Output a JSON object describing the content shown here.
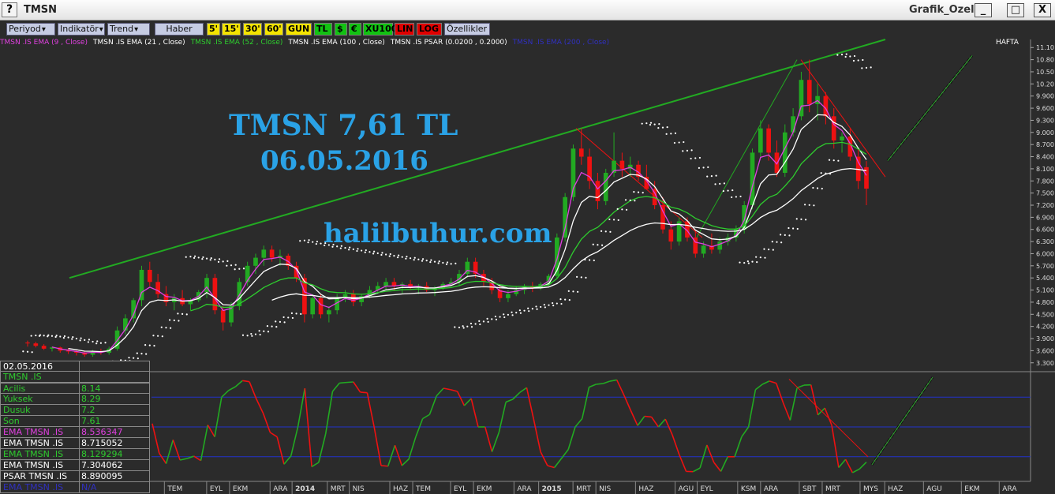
{
  "window": {
    "help_label": "?",
    "app_title": "TMSN",
    "doc_title": "Grafik_Ozel",
    "minimize_label": "_",
    "maximize_label": "□",
    "close_label": "X"
  },
  "toolbar": {
    "periyod": "Periyod",
    "indikator": "Indikatör",
    "trend": "Trend",
    "haber": "Haber",
    "t5": "5'",
    "t15": "15'",
    "t30": "30'",
    "t60": "60'",
    "gun": "GUN",
    "tl": "TL",
    "dollar": "$",
    "euro": "€",
    "xu100": "XU100",
    "lin": "LIN",
    "log": "LOG",
    "ozellikler": "Özellikler"
  },
  "legend": {
    "ema9": "TMSN .IS EMA (9 , Close)",
    "ema21": "TMSN .IS EMA (21 , Close)",
    "ema52": "TMSN .IS EMA (52 , Close)",
    "ema100": "TMSN .IS EMA (100 , Close)",
    "psar": "TMSN .IS PSAR (0.0200 , 0.2000)",
    "ema200": "TMSN .IS EMA (200 , Close)",
    "period": "HAFTA"
  },
  "watermark": {
    "line1": "TMSN 7,61 TL",
    "line2": "06.05.2016",
    "line3": "halilbuhur.com"
  },
  "colors": {
    "ema9": "#e040e0",
    "ema21": "#ffffff",
    "ema52": "#2ecc2e",
    "ema100": "#ffffff",
    "psar": "#ffffff",
    "ema200": "#3030c0",
    "up": "#22aa22",
    "down": "#ee1111",
    "watermark": "#2aa2e6"
  },
  "info_panel": {
    "date": "02.05.2016",
    "symbol": "TMSN .IS",
    "rows": [
      {
        "key": "Acilis",
        "value": "8.14",
        "color": "#2ecc2e"
      },
      {
        "key": "Yuksek",
        "value": "8.29",
        "color": "#2ecc2e"
      },
      {
        "key": "Dusuk",
        "value": "7.2",
        "color": "#2ecc2e"
      },
      {
        "key": "Son",
        "value": "7.61",
        "color": "#2ecc2e"
      },
      {
        "key": "EMA TMSN .IS",
        "value": "8.536347",
        "color": "#e040e0"
      },
      {
        "key": "EMA TMSN .IS",
        "value": "8.715052",
        "color": "#ffffff"
      },
      {
        "key": "EMA TMSN .IS",
        "value": "8.129294",
        "color": "#2ecc2e"
      },
      {
        "key": "EMA TMSN .IS",
        "value": "7.304062",
        "color": "#ffffff"
      },
      {
        "key": "PSAR TMSN .IS",
        "value": "8.890095",
        "color": "#ffffff"
      },
      {
        "key": "EMA TMSN .IS",
        "value": "N/A",
        "color": "#3030c0"
      }
    ]
  },
  "chart_data": {
    "type": "candlestick",
    "y_ticks": [
      "11.10",
      "10.80",
      "10.50",
      "10.20",
      "9.900",
      "9.600",
      "9.300",
      "9.000",
      "8.700",
      "8.400",
      "8.100",
      "7.800",
      "7.500",
      "7.200",
      "6.900",
      "6.600",
      "6.300",
      "6.000",
      "5.700",
      "5.400",
      "5.100",
      "4.800",
      "4.500",
      "4.200",
      "3.900",
      "3.600",
      "3.300"
    ],
    "ylim": [
      3.1,
      11.3
    ],
    "x_ticks": [
      {
        "label": "TEM",
        "pos": 0.02
      },
      {
        "label": "EYL",
        "pos": 0.068
      },
      {
        "label": "EKM",
        "pos": 0.094
      },
      {
        "label": "ARA",
        "pos": 0.14
      },
      {
        "label": "2014",
        "pos": 0.165
      },
      {
        "label": "MRT",
        "pos": 0.205
      },
      {
        "label": "NIS",
        "pos": 0.23
      },
      {
        "label": "HAZ",
        "pos": 0.276
      },
      {
        "label": "TEM",
        "pos": 0.302
      },
      {
        "label": "EYL",
        "pos": 0.345
      },
      {
        "label": "EKM",
        "pos": 0.371
      },
      {
        "label": "ARA",
        "pos": 0.417
      },
      {
        "label": "2015",
        "pos": 0.445
      },
      {
        "label": "MRT",
        "pos": 0.484
      },
      {
        "label": "NIS",
        "pos": 0.51
      },
      {
        "label": "HAZ",
        "pos": 0.555
      },
      {
        "label": "AGU",
        "pos": 0.6
      },
      {
        "label": "EYL",
        "pos": 0.625
      },
      {
        "label": "KSM",
        "pos": 0.671
      },
      {
        "label": "ARA",
        "pos": 0.697
      },
      {
        "label": "SBT",
        "pos": 0.741
      },
      {
        "label": "MRT",
        "pos": 0.767
      },
      {
        "label": "MYS",
        "pos": 0.81
      },
      {
        "label": "HAZ",
        "pos": 0.838
      },
      {
        "label": "AGU",
        "pos": 0.882
      },
      {
        "label": "EKM",
        "pos": 0.925
      },
      {
        "label": "ARA",
        "pos": 0.968
      }
    ],
    "ohlc": [
      [
        3.8,
        3.85,
        3.7,
        3.78
      ],
      [
        3.78,
        3.82,
        3.68,
        3.72
      ],
      [
        3.72,
        3.76,
        3.62,
        3.65
      ],
      [
        3.65,
        3.7,
        3.58,
        3.68
      ],
      [
        3.68,
        3.7,
        3.55,
        3.6
      ],
      [
        3.6,
        3.66,
        3.52,
        3.58
      ],
      [
        3.58,
        3.62,
        3.48,
        3.55
      ],
      [
        3.55,
        3.6,
        3.45,
        3.5
      ],
      [
        3.5,
        3.62,
        3.45,
        3.58
      ],
      [
        3.58,
        3.65,
        3.5,
        3.55
      ],
      [
        3.55,
        3.7,
        3.5,
        3.65
      ],
      [
        3.65,
        4.2,
        3.6,
        4.1
      ],
      [
        4.1,
        4.5,
        4.0,
        4.4
      ],
      [
        4.4,
        4.9,
        4.3,
        4.85
      ],
      [
        4.85,
        5.7,
        4.7,
        5.6
      ],
      [
        5.6,
        5.8,
        5.2,
        5.3
      ],
      [
        5.3,
        5.5,
        4.9,
        5.0
      ],
      [
        5.0,
        5.2,
        4.7,
        4.8
      ],
      [
        4.8,
        5.0,
        4.6,
        4.9
      ],
      [
        4.9,
        5.1,
        4.7,
        4.75
      ],
      [
        4.75,
        4.9,
        4.6,
        4.85
      ],
      [
        4.85,
        5.1,
        4.8,
        5.05
      ],
      [
        5.05,
        5.5,
        4.9,
        5.4
      ],
      [
        5.4,
        5.5,
        4.5,
        4.6
      ],
      [
        4.6,
        4.7,
        4.1,
        4.3
      ],
      [
        4.3,
        4.8,
        4.2,
        4.7
      ],
      [
        4.7,
        5.4,
        4.6,
        5.3
      ],
      [
        5.3,
        5.8,
        5.2,
        5.7
      ],
      [
        5.7,
        6.0,
        5.5,
        5.9
      ],
      [
        5.9,
        6.2,
        5.7,
        6.1
      ],
      [
        6.1,
        6.2,
        5.8,
        5.9
      ],
      [
        5.9,
        6.1,
        5.7,
        5.95
      ],
      [
        5.95,
        6.0,
        5.6,
        5.7
      ],
      [
        5.7,
        5.8,
        5.3,
        5.4
      ],
      [
        5.4,
        5.5,
        4.3,
        4.5
      ],
      [
        4.5,
        5.0,
        4.4,
        4.9
      ],
      [
        4.9,
        5.0,
        4.4,
        4.5
      ],
      [
        4.5,
        4.7,
        4.3,
        4.6
      ],
      [
        4.6,
        5.0,
        4.5,
        4.9
      ],
      [
        4.9,
        5.1,
        4.8,
        5.0
      ],
      [
        5.0,
        5.1,
        4.7,
        4.8
      ],
      [
        4.8,
        5.0,
        4.7,
        4.95
      ],
      [
        4.95,
        5.2,
        4.9,
        5.1
      ],
      [
        5.1,
        5.3,
        5.0,
        5.2
      ],
      [
        5.2,
        5.4,
        5.1,
        5.3
      ],
      [
        5.3,
        5.4,
        5.1,
        5.2
      ],
      [
        5.2,
        5.3,
        5.0,
        5.25
      ],
      [
        5.25,
        5.35,
        5.1,
        5.15
      ],
      [
        5.15,
        5.25,
        5.0,
        5.2
      ],
      [
        5.2,
        5.3,
        5.05,
        5.1
      ],
      [
        5.1,
        5.2,
        4.95,
        5.15
      ],
      [
        5.15,
        5.3,
        5.1,
        5.25
      ],
      [
        5.25,
        5.4,
        5.2,
        5.3
      ],
      [
        5.3,
        5.6,
        5.2,
        5.5
      ],
      [
        5.5,
        5.9,
        5.4,
        5.8
      ],
      [
        5.8,
        5.9,
        5.4,
        5.5
      ],
      [
        5.5,
        5.6,
        5.2,
        5.3
      ],
      [
        5.3,
        5.4,
        5.0,
        5.1
      ],
      [
        5.1,
        5.2,
        4.8,
        4.9
      ],
      [
        4.9,
        5.1,
        4.8,
        5.0
      ],
      [
        5.0,
        5.2,
        4.95,
        5.1
      ],
      [
        5.1,
        5.25,
        5.0,
        5.2
      ],
      [
        5.2,
        5.3,
        5.05,
        5.15
      ],
      [
        5.15,
        5.3,
        5.1,
        5.25
      ],
      [
        5.25,
        5.5,
        5.2,
        5.45
      ],
      [
        5.45,
        6.5,
        5.4,
        6.4
      ],
      [
        6.4,
        7.5,
        6.3,
        7.4
      ],
      [
        7.4,
        8.7,
        7.3,
        8.6
      ],
      [
        8.6,
        9.1,
        8.2,
        8.4
      ],
      [
        8.4,
        8.6,
        7.6,
        7.8
      ],
      [
        7.8,
        8.0,
        7.1,
        7.3
      ],
      [
        7.3,
        8.1,
        7.2,
        8.0
      ],
      [
        8.0,
        9.0,
        7.9,
        8.3
      ],
      [
        8.3,
        8.5,
        7.9,
        8.1
      ],
      [
        8.1,
        8.4,
        7.9,
        8.2
      ],
      [
        8.2,
        8.3,
        7.8,
        7.9
      ],
      [
        7.9,
        8.2,
        7.7,
        7.6
      ],
      [
        7.6,
        7.8,
        7.1,
        7.2
      ],
      [
        7.2,
        7.4,
        6.5,
        6.6
      ],
      [
        6.6,
        6.8,
        6.1,
        6.3
      ],
      [
        6.3,
        6.9,
        6.2,
        6.8
      ],
      [
        6.8,
        6.9,
        6.3,
        6.4
      ],
      [
        6.4,
        6.6,
        5.9,
        6.0
      ],
      [
        6.0,
        6.3,
        5.9,
        6.2
      ],
      [
        6.2,
        6.5,
        6.0,
        6.1
      ],
      [
        6.1,
        6.4,
        6.0,
        6.3
      ],
      [
        6.3,
        6.5,
        6.2,
        6.4
      ],
      [
        6.4,
        6.7,
        6.3,
        6.6
      ],
      [
        6.6,
        7.3,
        6.5,
        7.2
      ],
      [
        7.2,
        8.6,
        7.1,
        8.5
      ],
      [
        8.5,
        9.3,
        8.4,
        9.1
      ],
      [
        9.1,
        9.2,
        8.3,
        8.5
      ],
      [
        8.5,
        8.8,
        7.9,
        8.0
      ],
      [
        8.0,
        9.2,
        7.9,
        9.0
      ],
      [
        9.0,
        9.6,
        8.9,
        9.4
      ],
      [
        9.4,
        10.5,
        9.3,
        10.3
      ],
      [
        10.3,
        10.8,
        9.5,
        9.7
      ],
      [
        9.7,
        10.2,
        9.3,
        9.9
      ],
      [
        9.9,
        10.0,
        9.2,
        9.4
      ],
      [
        9.4,
        9.6,
        8.6,
        8.8
      ],
      [
        8.8,
        9.0,
        8.5,
        8.9
      ],
      [
        8.9,
        9.1,
        8.3,
        8.4
      ],
      [
        8.4,
        8.6,
        7.6,
        7.8
      ],
      [
        8.14,
        8.29,
        7.2,
        7.61
      ]
    ],
    "oscillator": {
      "levels": [
        80,
        50,
        20
      ]
    }
  }
}
